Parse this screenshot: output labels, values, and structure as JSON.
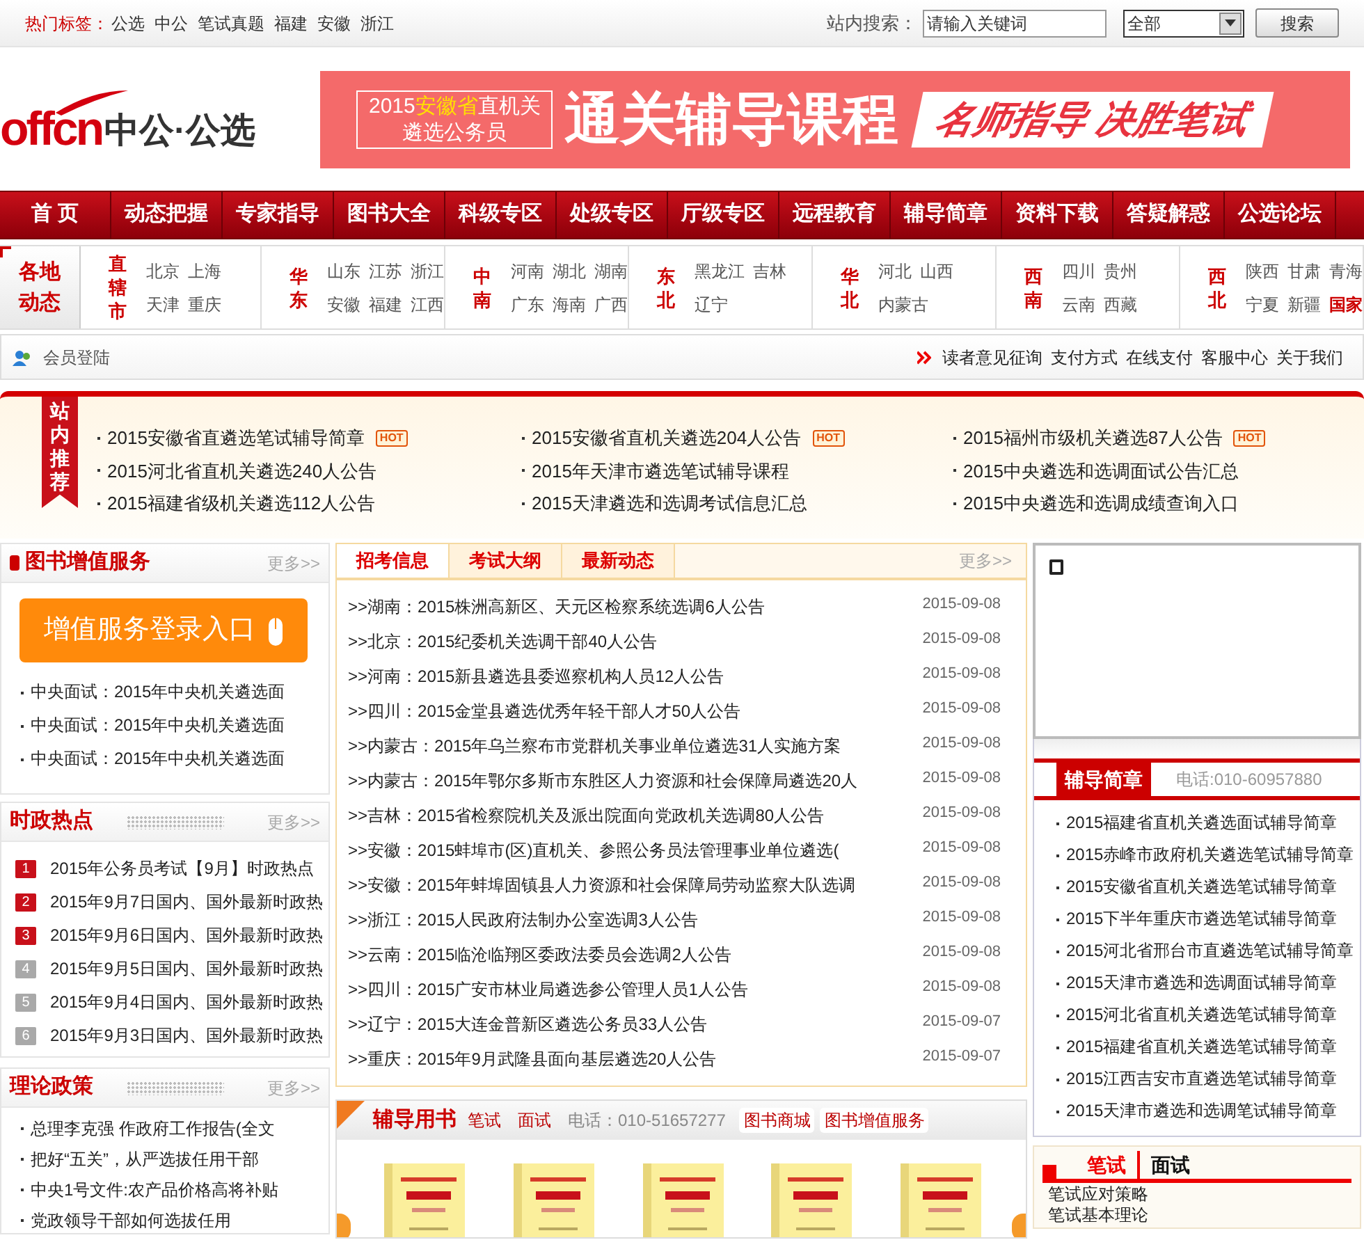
{
  "top_bar": {
    "hot_label": "热门标签：",
    "hot_tags": [
      "公选",
      "中公",
      "笔试真题",
      "福建",
      "安徽",
      "浙江"
    ],
    "search_label": "站内搜索：",
    "search": {
      "placeholder": "请输入关键词"
    },
    "scope": "全部",
    "search_button": "搜索"
  },
  "header": {
    "logo_word": "offcn",
    "logo_name": "中公·公选",
    "banner": {
      "line1": [
        {
          "text": "2015",
          "highlight": false
        },
        {
          "text": "安徽省",
          "highlight": true
        },
        {
          "text": "直机关",
          "highlight": false
        }
      ],
      "line2": "遴选公务员",
      "headline": "通关辅导课程",
      "slogan": "名师指导 决胜笔试"
    }
  },
  "nav": [
    "首 页",
    "动态把握",
    "专家指导",
    "图书大全",
    "科级专区",
    "处级专区",
    "厅级专区",
    "远程教育",
    "辅导简章",
    "资料下载",
    "答疑解惑",
    "公选论坛"
  ],
  "regions": {
    "title": "各地动态",
    "groups": [
      {
        "label": "直辖市",
        "rows": [
          [
            {
              "name": "北京",
              "highlight": false
            },
            {
              "name": "上海",
              "highlight": false
            }
          ],
          [
            {
              "name": "天津",
              "highlight": false
            },
            {
              "name": "重庆",
              "highlight": false
            }
          ]
        ]
      },
      {
        "label": "华东",
        "rows": [
          [
            {
              "name": "山东",
              "highlight": false
            },
            {
              "name": "江苏",
              "highlight": false
            },
            {
              "name": "浙江",
              "highlight": false
            }
          ],
          [
            {
              "name": "安徽",
              "highlight": false
            },
            {
              "name": "福建",
              "highlight": false
            },
            {
              "name": "江西",
              "highlight": false
            }
          ]
        ]
      },
      {
        "label": "中南",
        "rows": [
          [
            {
              "name": "河南",
              "highlight": false
            },
            {
              "name": "湖北",
              "highlight": false
            },
            {
              "name": "湖南",
              "highlight": false
            }
          ],
          [
            {
              "name": "广东",
              "highlight": false
            },
            {
              "name": "海南",
              "highlight": false
            },
            {
              "name": "广西",
              "highlight": false
            }
          ]
        ]
      },
      {
        "label": "东北",
        "rows": [
          [
            {
              "name": "黑龙江",
              "highlight": false
            },
            {
              "name": "吉林",
              "highlight": false
            }
          ],
          [
            {
              "name": "辽宁",
              "highlight": false
            }
          ]
        ]
      },
      {
        "label": "华北",
        "rows": [
          [
            {
              "name": "河北",
              "highlight": false
            },
            {
              "name": "山西",
              "highlight": false
            }
          ],
          [
            {
              "name": "内蒙古",
              "highlight": false
            }
          ]
        ]
      },
      {
        "label": "西南",
        "rows": [
          [
            {
              "name": "四川",
              "highlight": false
            },
            {
              "name": "贵州",
              "highlight": false
            }
          ],
          [
            {
              "name": "云南",
              "highlight": false
            },
            {
              "name": "西藏",
              "highlight": false
            }
          ]
        ]
      },
      {
        "label": "西北",
        "rows": [
          [
            {
              "name": "陕西",
              "highlight": false
            },
            {
              "name": "甘肃",
              "highlight": false
            },
            {
              "name": "青海",
              "highlight": false
            }
          ],
          [
            {
              "name": "宁夏",
              "highlight": false
            },
            {
              "name": "新疆",
              "highlight": false
            },
            {
              "name": "国家",
              "highlight": true
            }
          ]
        ]
      }
    ]
  },
  "member_bar": {
    "login": "会员登陆",
    "links": [
      "读者意见征询",
      "支付方式",
      "在线支付",
      "客服中心",
      "关于我们"
    ]
  },
  "recommend": {
    "title": "站内推荐",
    "items": [
      {
        "text": "2015安徽省直遴选笔试辅导简章",
        "badge": "HOT"
      },
      {
        "text": "2015安徽省直机关遴选204人公告",
        "badge": "HOT"
      },
      {
        "text": "2015福州市级机关遴选87人公告",
        "badge": "HOT"
      },
      {
        "text": "2015河北省直机关遴选240人公告"
      },
      {
        "text": "2015年天津市遴选笔试辅导课程"
      },
      {
        "text": "2015中央遴选和选调面试公告汇总"
      },
      {
        "text": "2015福建省级机关遴选112人公告"
      },
      {
        "text": "2015天津遴选和选调考试信息汇总"
      },
      {
        "text": "2015中央遴选和选调成绩查询入口"
      }
    ]
  },
  "book_service": {
    "title": "图书增值服务",
    "more": "更多>>",
    "login_button": "增值服务登录入口",
    "items": [
      "中央面试：2015年中央机关遴选面",
      "中央面试：2015年中央机关遴选面",
      "中央面试：2015年中央机关遴选面"
    ]
  },
  "hot_topics": {
    "title": "时政热点",
    "more": "更多>>",
    "items": [
      {
        "rank": "1",
        "color": "#c8101a",
        "text": "2015年公务员考试【9月】时政热点"
      },
      {
        "rank": "2",
        "color": "#c8101a",
        "text": "2015年9月7日国内、国外最新时政热"
      },
      {
        "rank": "3",
        "color": "#c8101a",
        "text": "2015年9月6日国内、国外最新时政热"
      },
      {
        "rank": "4",
        "color": "#a9a9a9",
        "text": "2015年9月5日国内、国外最新时政热"
      },
      {
        "rank": "5",
        "color": "#a9a9a9",
        "text": "2015年9月4日国内、国外最新时政热"
      },
      {
        "rank": "6",
        "color": "#a9a9a9",
        "text": "2015年9月3日国内、国外最新时政热"
      }
    ]
  },
  "policy": {
    "title": "理论政策",
    "more": "更多>>",
    "items": [
      "总理李克强 作政府工作报告(全文",
      "把好“五关”，从严选拔任用干部",
      "中央1号文件:农产品价格高将补贴",
      "党政领导干部如何选拔任用"
    ]
  },
  "news": {
    "tabs": [
      {
        "label": "招考信息",
        "selected": true
      },
      {
        "label": "考试大纲",
        "selected": false
      },
      {
        "label": "最新动态",
        "selected": false
      }
    ],
    "more": "更多>>",
    "items": [
      {
        "title": ">>湖南：2015株洲高新区、天元区检察系统选调6人公告",
        "date": "2015-09-08"
      },
      {
        "title": ">>北京：2015纪委机关选调干部40人公告",
        "date": "2015-09-08"
      },
      {
        "title": ">>河南：2015新县遴选县委巡察机构人员12人公告",
        "date": "2015-09-08"
      },
      {
        "title": ">>四川：2015金堂县遴选优秀年轻干部人才50人公告",
        "date": "2015-09-08"
      },
      {
        "title": ">>内蒙古：2015年乌兰察布市党群机关事业单位遴选31人实施方案",
        "date": "2015-09-08"
      },
      {
        "title": ">>内蒙古：2015年鄂尔多斯市东胜区人力资源和社会保障局遴选20人",
        "date": "2015-09-08"
      },
      {
        "title": ">>吉林：2015省检察院机关及派出院面向党政机关选调80人公告",
        "date": "2015-09-08"
      },
      {
        "title": ">>安徽：2015蚌埠市(区)直机关、参照公务员法管理事业单位遴选(",
        "date": "2015-09-08"
      },
      {
        "title": ">>安徽：2015年蚌埠固镇县人力资源和社会保障局劳动监察大队选调",
        "date": "2015-09-08"
      },
      {
        "title": ">>浙江：2015人民政府法制办公室选调3人公告",
        "date": "2015-09-08"
      },
      {
        "title": ">>云南：2015临沧临翔区委政法委员会选调2人公告",
        "date": "2015-09-08"
      },
      {
        "title": ">>四川：2015广安市林业局遴选参公管理人员1人公告",
        "date": "2015-09-08"
      },
      {
        "title": ">>辽宁：2015大连金普新区遴选公务员33人公告",
        "date": "2015-09-07"
      },
      {
        "title": ">>重庆：2015年9月武隆县面向基层遴选20人公告",
        "date": "2015-09-07"
      }
    ]
  },
  "books": {
    "title": "辅导用书",
    "links": [
      "笔试",
      "面试"
    ],
    "phone": "电话：010-51657277",
    "shop_links": [
      "图书商城",
      "图书增值服务"
    ],
    "covers": [
      {
        "kind": "picture"
      },
      {
        "kind": "picture"
      },
      {
        "kind": "picture"
      },
      {
        "kind": "picture"
      },
      {
        "kind": "picture"
      }
    ]
  },
  "guides": {
    "title": "辅导简章",
    "phone": "电话:010-60957880",
    "items": [
      "2015福建省直机关遴选面试辅导简章",
      "2015赤峰市政府机关遴选笔试辅导简章",
      "2015安徽省直机关遴选笔试辅导简章",
      "2015下半年重庆市遴选笔试辅导简章",
      "2015河北省邢台市直遴选笔试辅导简章",
      "2015天津市遴选和选调面试辅导简章",
      "2015河北省直机关遴选笔试辅导简章",
      "2015福建省直机关遴选笔试辅导简章",
      "2015江西吉安市直遴选笔试辅导简章",
      "2015天津市遴选和选调笔试辅导简章"
    ]
  },
  "exam_tips": {
    "tabs": [
      {
        "label": "笔试",
        "selected": true
      },
      {
        "label": "面试",
        "selected": false
      }
    ],
    "items": [
      "笔试应对策略",
      "笔试基本理论"
    ]
  }
}
